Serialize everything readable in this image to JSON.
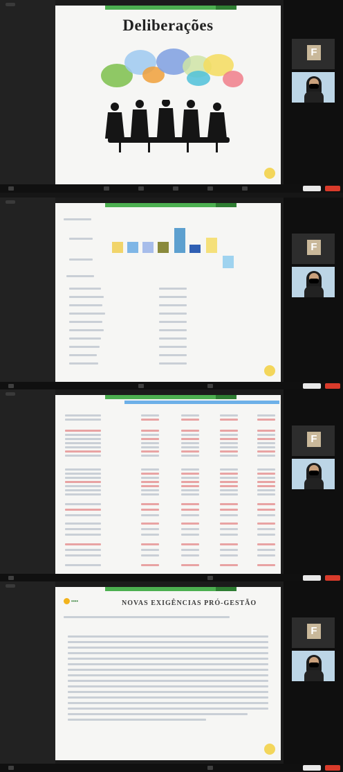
{
  "slides": [
    {
      "title": "Deliberações"
    },
    {
      "bar_colors": [
        "#f1d46a",
        "#7fb6e6",
        "#a7bdea",
        "#8a8a3c",
        "#5da0cf",
        "#2f5fb3",
        "#f5e07a",
        "#9fd3ef"
      ]
    },
    {},
    {
      "title": "NOVAS EXIGÊNCIAS PRÓ-GESTÃO"
    }
  ],
  "participants": {
    "initial": "F"
  },
  "colors": {
    "accent_green": "#4caf50",
    "end_button": "#d93b2b",
    "badge": "#f3d65b"
  }
}
